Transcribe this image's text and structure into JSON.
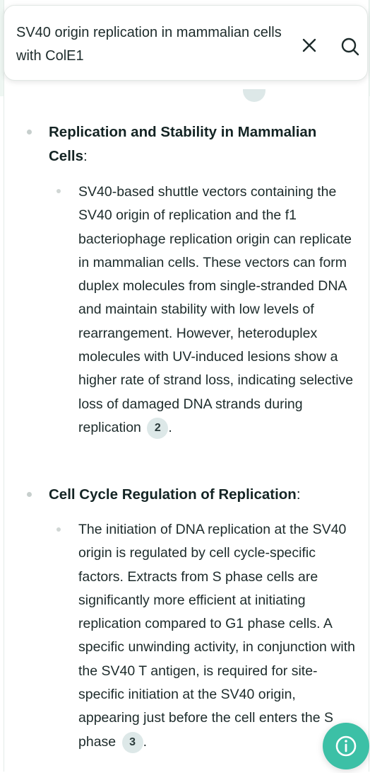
{
  "search": {
    "query": "SV40 origin replication in mammalian cells with ColE1"
  },
  "icons": {
    "clear": "close-icon",
    "search": "search-icon",
    "info": "info-icon"
  },
  "colors": {
    "accent": "#3cc0a6",
    "citation_bg": "#dde8e8"
  },
  "sections": [
    {
      "heading": "Replication and Stability in Mammalian Cells",
      "heading_suffix": ":",
      "text": "SV40-based shuttle vectors containing the SV40 origin of replication and the f1 bacteriophage replication origin can replicate in mammalian cells. These vectors can form duplex molecules from single-stranded DNA and maintain stability with low levels of rearrangement. However, heteroduplex molecules with UV-induced lesions show a higher rate of strand loss, indicating selective loss of damaged DNA strands during replication",
      "citation": "2",
      "trail": "."
    },
    {
      "heading": "Cell Cycle Regulation of Replication",
      "heading_suffix": ":",
      "text": "The initiation of DNA replication at the SV40 origin is regulated by cell cycle-specific factors. Extracts from S phase cells are significantly more efficient at initiating replication compared to G1 phase cells. A specific unwinding activity, in conjunction with the SV40 T antigen, is required for site-specific initiation at the SV40 origin, appearing just before the cell enters the S phase",
      "citation": "3",
      "trail": "."
    }
  ]
}
